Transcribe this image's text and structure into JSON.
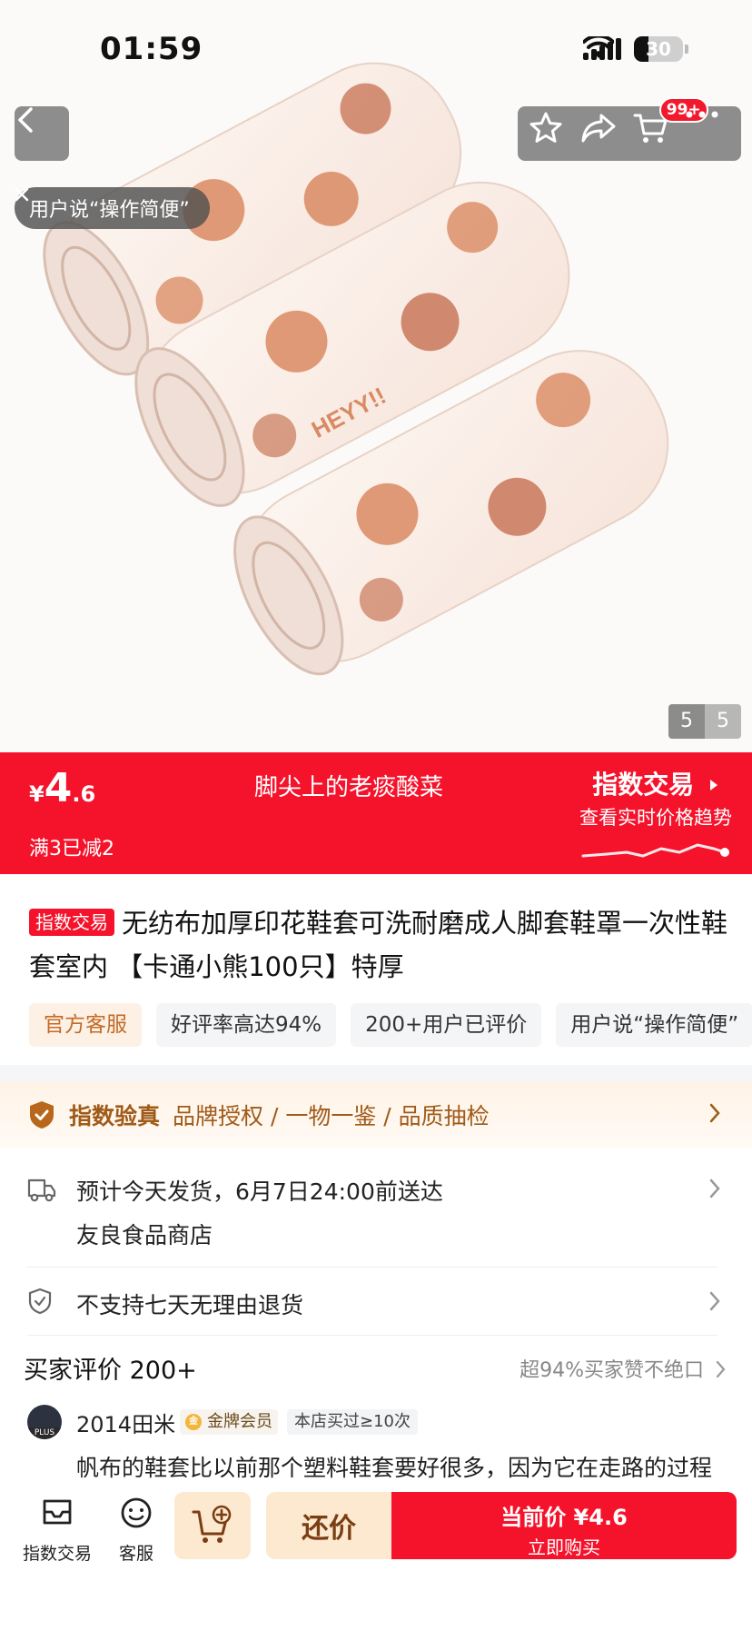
{
  "status_bar": {
    "time": "01:59",
    "battery": "30",
    "battery_level": 0.3
  },
  "hero": {
    "voice_tag": "用户说“操作简便”",
    "image_index": "5",
    "image_total": "5",
    "cart_badge": "99+"
  },
  "price_banner": {
    "currency": "¥",
    "price_int": "4",
    "price_dec": ".6",
    "promo": "满3已减2",
    "store_title": "脚尖上的老痰酸菜",
    "brand": "指数交易",
    "brand_sub": "查看实时价格趋势"
  },
  "product": {
    "badge": "指数交易",
    "title": "无纺布加厚印花鞋套可洗耐磨成人脚套鞋罩一次性鞋套室内 【卡通小熊100只】特厚",
    "tags": [
      "官方客服",
      "好评率高达94%",
      "200+用户已评价",
      "用户说“操作简便”"
    ]
  },
  "verify": {
    "name": "指数验真",
    "items": "品牌授权 / 一物一鉴 / 品质抽检"
  },
  "shipping": {
    "line1": "预计今天发货，6月7日24:00前送达",
    "line2": "友良食品商店"
  },
  "returns": {
    "text": "不支持七天无理由退货"
  },
  "reviews": {
    "heading": "买家评价 200+",
    "summary": "超94%买家赞不绝口",
    "reviewer": "2014田米",
    "member_label": "金牌会员",
    "member_coin": "金",
    "avatar_badge": "PLUS",
    "bought": "本店买过≥10次",
    "text": "帆布的鞋套比以前那个塑料鞋套要好很多，因为它在走路的过程"
  },
  "bottom_bar": {
    "index_trade": "指数交易",
    "service": "客服",
    "bargain": "还价",
    "buy_line1": "当前价 ¥4.6",
    "buy_line2": "立即购买"
  },
  "colors": {
    "accent_red": "#f5132c",
    "badge_red": "#f2192c",
    "gold_brown": "#a05a18",
    "cream": "#fde9cf"
  },
  "icons": [
    "back-icon",
    "star-icon",
    "share-icon",
    "cart-icon",
    "more-icon",
    "close-icon",
    "shield-icon",
    "truck-icon",
    "return-shield-icon",
    "chevron-right-icon",
    "index-trade-icon",
    "service-icon",
    "add-cart-icon"
  ]
}
